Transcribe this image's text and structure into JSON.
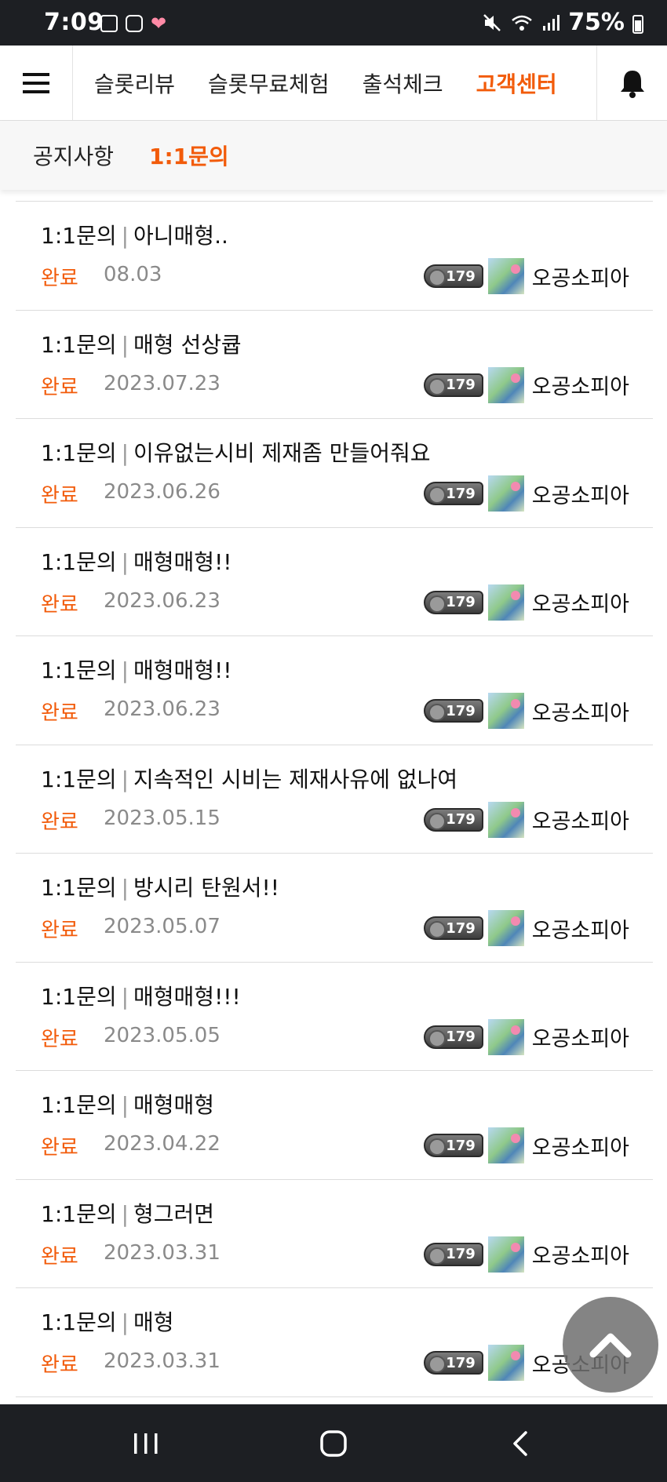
{
  "status_bar": {
    "time": "7:09",
    "battery_pct": "75%",
    "icons": [
      "image-icon",
      "clock-app-icon",
      "heart-icon",
      "mute-icon",
      "wifi-icon",
      "signal-icon",
      "battery-icon"
    ]
  },
  "nav": {
    "menu_icon": "hamburger-menu-icon",
    "links": [
      "슬롯리뷰",
      "슬롯무료체험",
      "출석체크",
      "고객센터"
    ],
    "active_link": "고객센터",
    "bell_icon": "bell-icon"
  },
  "subtabs": {
    "items": [
      "공지사항",
      "1:1문의"
    ],
    "active": "1:1문의"
  },
  "accent_color": "#f25b0a",
  "list": {
    "items": [
      {
        "category": "1:1문의",
        "title": "아니매형..",
        "status": "완료",
        "date": "08.03",
        "level": "179",
        "author": "오공소피아"
      },
      {
        "category": "1:1문의",
        "title": "매형 선상큡",
        "status": "완료",
        "date": "2023.07.23",
        "level": "179",
        "author": "오공소피아"
      },
      {
        "category": "1:1문의",
        "title": "이유없는시비 제재좀 만들어줘요",
        "status": "완료",
        "date": "2023.06.26",
        "level": "179",
        "author": "오공소피아"
      },
      {
        "category": "1:1문의",
        "title": "매형매형!!",
        "status": "완료",
        "date": "2023.06.23",
        "level": "179",
        "author": "오공소피아"
      },
      {
        "category": "1:1문의",
        "title": "매형매형!!",
        "status": "완료",
        "date": "2023.06.23",
        "level": "179",
        "author": "오공소피아"
      },
      {
        "category": "1:1문의",
        "title": "지속적인 시비는 제재사유에 없나여",
        "status": "완료",
        "date": "2023.05.15",
        "level": "179",
        "author": "오공소피아"
      },
      {
        "category": "1:1문의",
        "title": "방시리 탄원서!!",
        "status": "완료",
        "date": "2023.05.07",
        "level": "179",
        "author": "오공소피아"
      },
      {
        "category": "1:1문의",
        "title": "매형매형!!!",
        "status": "완료",
        "date": "2023.05.05",
        "level": "179",
        "author": "오공소피아"
      },
      {
        "category": "1:1문의",
        "title": "매형매형",
        "status": "완료",
        "date": "2023.04.22",
        "level": "179",
        "author": "오공소피아"
      },
      {
        "category": "1:1문의",
        "title": "형그러면",
        "status": "완료",
        "date": "2023.03.31",
        "level": "179",
        "author": "오공소피아"
      },
      {
        "category": "1:1문의",
        "title": "매형",
        "status": "완료",
        "date": "2023.03.31",
        "level": "179",
        "author": "오공소피아"
      }
    ]
  },
  "scroll_top_icon": "chevron-up-icon",
  "bottom_nav": [
    "recent-apps-icon",
    "home-icon",
    "back-icon"
  ]
}
